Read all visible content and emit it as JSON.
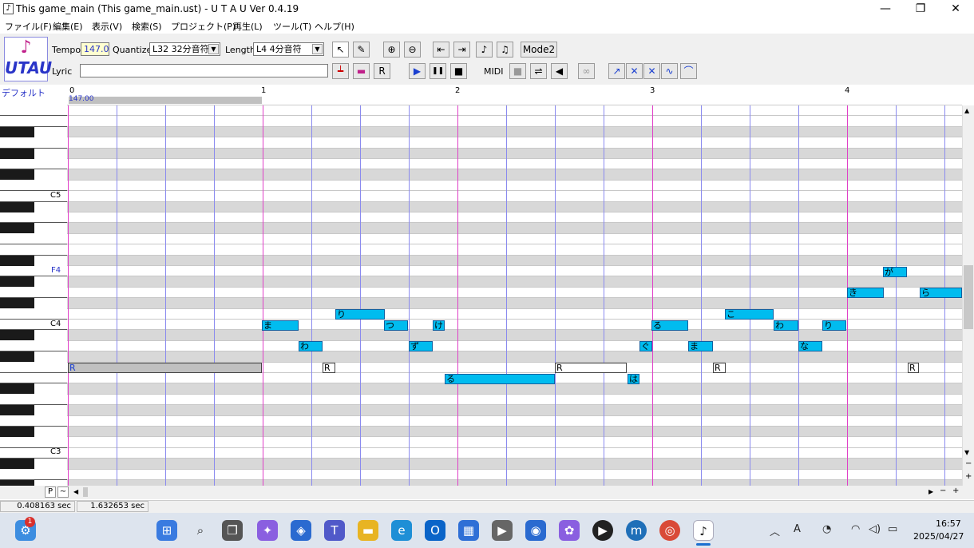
{
  "window": {
    "title": "This game_main (This game_main.ust) - U T A U Ver 0.4.19",
    "app_icon": "♪",
    "minimize": "—",
    "restore": "❐",
    "close": "✕"
  },
  "menu": [
    "ファイル(F)",
    "編集(E)",
    "表示(V)",
    "検索(S)",
    "プロジェクト(P)",
    "再生(L)",
    "ツール(T)",
    "ヘルプ(H)"
  ],
  "logo": {
    "note": "♪",
    "text": "UTAU"
  },
  "toolbar": {
    "tempo_label": "Tempo",
    "tempo_value": "147.0",
    "quantize_label": "Quantize",
    "quantize_value": "L32 32分音符",
    "length_label": "Length",
    "length_value": "L4  4分音符",
    "lyric_label": "Lyric",
    "lyric_value": "",
    "mode_button": "Mode2",
    "midi_label": "MIDI",
    "play": "▶",
    "pause": "❚❚",
    "stop": "■"
  },
  "track": {
    "name": "デフォルト",
    "tempo_marker": "147.00",
    "measures": [
      "0",
      "1",
      "2",
      "3",
      "4"
    ]
  },
  "keys": {
    "c5": "C5",
    "f4": "F4",
    "c4": "C4",
    "c3": "C3"
  },
  "notes": [
    {
      "lyric": "R",
      "pitch": "C4",
      "rest": true
    },
    {
      "lyric": "ま",
      "pitch": "E4"
    },
    {
      "lyric": "わ",
      "pitch": "D4"
    },
    {
      "lyric": "R",
      "pitch": "C4",
      "rest": true
    },
    {
      "lyric": "り",
      "pitch": "F4"
    },
    {
      "lyric": "つ",
      "pitch": "E4"
    },
    {
      "lyric": "ず",
      "pitch": "D4"
    },
    {
      "lyric": "け",
      "pitch": "E4"
    },
    {
      "lyric": "る",
      "pitch": "B3"
    },
    {
      "lyric": "R",
      "pitch": "C4",
      "rest": true
    },
    {
      "lyric": "は",
      "pitch": "B3"
    },
    {
      "lyric": "ぐ",
      "pitch": "D4"
    },
    {
      "lyric": "る",
      "pitch": "E4"
    },
    {
      "lyric": "ま",
      "pitch": "D4"
    },
    {
      "lyric": "R",
      "pitch": "C4",
      "rest": true
    },
    {
      "lyric": "こ",
      "pitch": "F4"
    },
    {
      "lyric": "わ",
      "pitch": "E4"
    },
    {
      "lyric": "な",
      "pitch": "D4"
    },
    {
      "lyric": "り",
      "pitch": "E4"
    },
    {
      "lyric": "き",
      "pitch": "G4"
    },
    {
      "lyric": "R",
      "pitch": "C4",
      "rest": true
    },
    {
      "lyric": "が",
      "pitch": "A4"
    },
    {
      "lyric": "ら",
      "pitch": "G4"
    }
  ],
  "status": {
    "pos1": "0.408163 sec",
    "pos2": "1.632653 sec"
  },
  "scroll": {
    "p_btn": "P",
    "tilde_btn": "~",
    "minus": "−",
    "plus": "+"
  },
  "taskbar": {
    "badge": "1",
    "time": "16:57",
    "date": "2025/04/27",
    "ime": "A"
  }
}
